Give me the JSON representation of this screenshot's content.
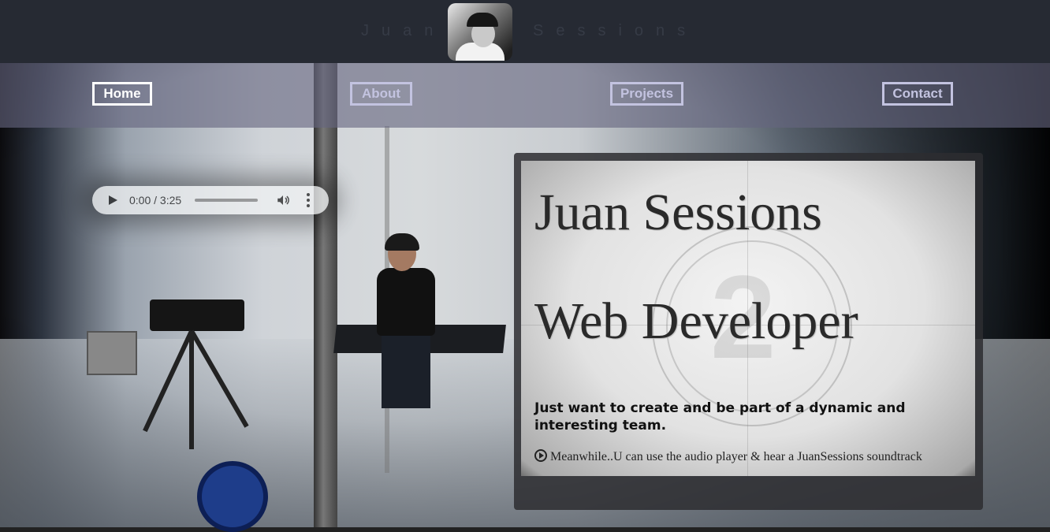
{
  "header": {
    "brand_left": "Juan",
    "brand_right": "Sessions",
    "logo_alt": "Juan Sessions avatar"
  },
  "nav": {
    "items": [
      {
        "label": "Home",
        "active": true
      },
      {
        "label": "About",
        "active": false
      },
      {
        "label": "Projects",
        "active": false
      },
      {
        "label": "Contact",
        "active": false
      }
    ]
  },
  "player": {
    "time": "0:00 / 3:25",
    "progress": 0
  },
  "hero": {
    "title": "Juan Sessions",
    "subtitle": "Web Developer",
    "tagline": "Just want to create and be part of a dynamic and interesting team.",
    "note": "Meanwhile..U can use the audio player & hear a JuanSessions soundtrack",
    "countdown_digit": "2"
  },
  "icons": {
    "play": "play-icon",
    "volume": "volume-icon",
    "more": "more-options-icon",
    "note_play": "play-circle-icon"
  },
  "colors": {
    "header_bg": "#262a33",
    "nav_bg": "#666680",
    "nav_border": "#c3c3e0",
    "nav_active": "#ffffff"
  }
}
